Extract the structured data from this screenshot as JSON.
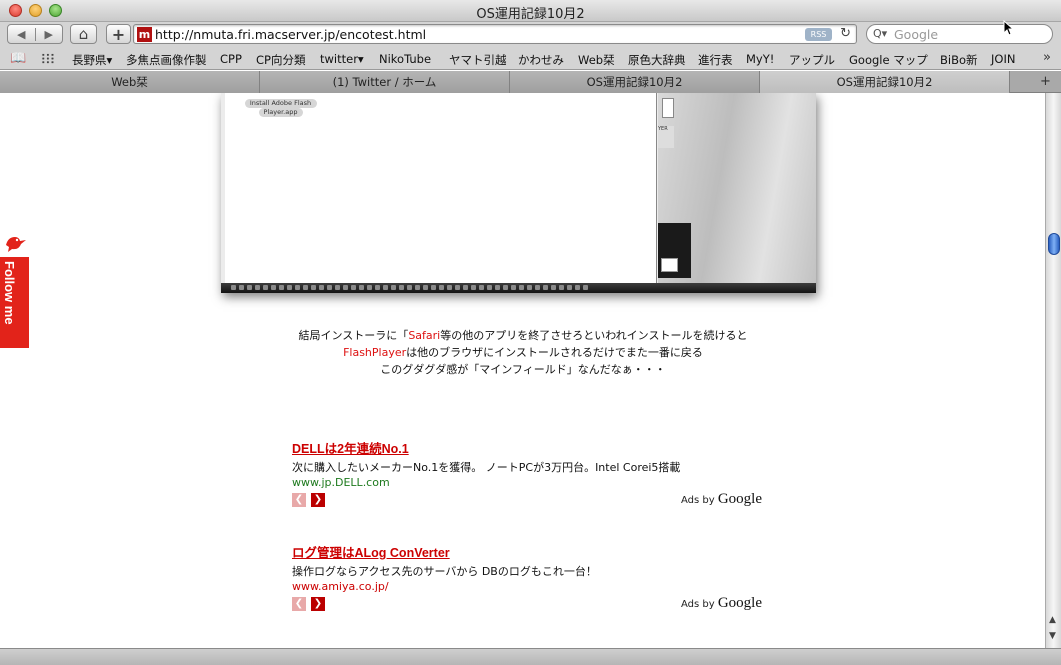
{
  "window": {
    "title": "OS運用記録10月2"
  },
  "toolbar": {
    "back_glyph": "◀",
    "forward_glyph": "▶",
    "home_glyph": "⌂",
    "add_glyph": "+",
    "url": "http://nmuta.fri.macserver.jp/encotest.html",
    "favicon_letter": "m",
    "rss_label": "RSS",
    "reload_glyph": "↻",
    "search_placeholder": "Google",
    "search_icon_glyph": "Q▾"
  },
  "bookmarks": {
    "items": [
      "長野県▾",
      "多焦点画像作製",
      "CPP",
      "CP向分類",
      "twitter▾",
      "NikoTube",
      "ヤマト引越",
      "かわせみ",
      "Web栞",
      "原色大辞典",
      "進行表",
      "MyY!",
      "アップル",
      "Google マップ",
      "BiBo新",
      "JOIN"
    ],
    "more_glyph": "»"
  },
  "tabs": {
    "items": [
      {
        "label": "Web栞"
      },
      {
        "label": "(1) Twitter / ホーム"
      },
      {
        "label": "OS運用記録10月2"
      },
      {
        "label": "OS運用記録10月2"
      }
    ],
    "add_glyph": "+"
  },
  "screenshot": {
    "installer_line1": "Install Adobe Flash",
    "installer_line2": "Player.app",
    "btn_text": "YER"
  },
  "follow": {
    "label": "Follow me"
  },
  "caption": {
    "line1_pre": "結局インストーラに「",
    "line1_red": "Safari",
    "line1_post": "等の他のアプリを終了させろといわれインストールを続けると",
    "line2_red": "FlashPlayer",
    "line2_post": "は他のブラウザにインストールされるだけでまた一番に戻る",
    "line3": "このグダグダ感が「マインフィールド」なんだなぁ・・・"
  },
  "ads": [
    {
      "title": "DELLは2年連続No.1",
      "desc": "次に購入したいメーカーNo.1を獲得。 ノートPCが3万円台。Intel Corei5搭載",
      "url": "www.jp.DELL.com",
      "adsby": "Ads by ",
      "adsby_brand": "Google"
    },
    {
      "title": "ログ管理はALog ConVerter",
      "desc": "操作ログならアクセス先のサーバから DBのログもこれ一台！",
      "url": "www.amiya.co.jp/",
      "adsby": "Ads by ",
      "adsby_brand": "Google"
    }
  ],
  "colors": {
    "accent_red": "#cc0000",
    "follow_red": "#e2231a",
    "url_green": "#1e7a1e",
    "scroll_blue": "#2a5fc0"
  }
}
